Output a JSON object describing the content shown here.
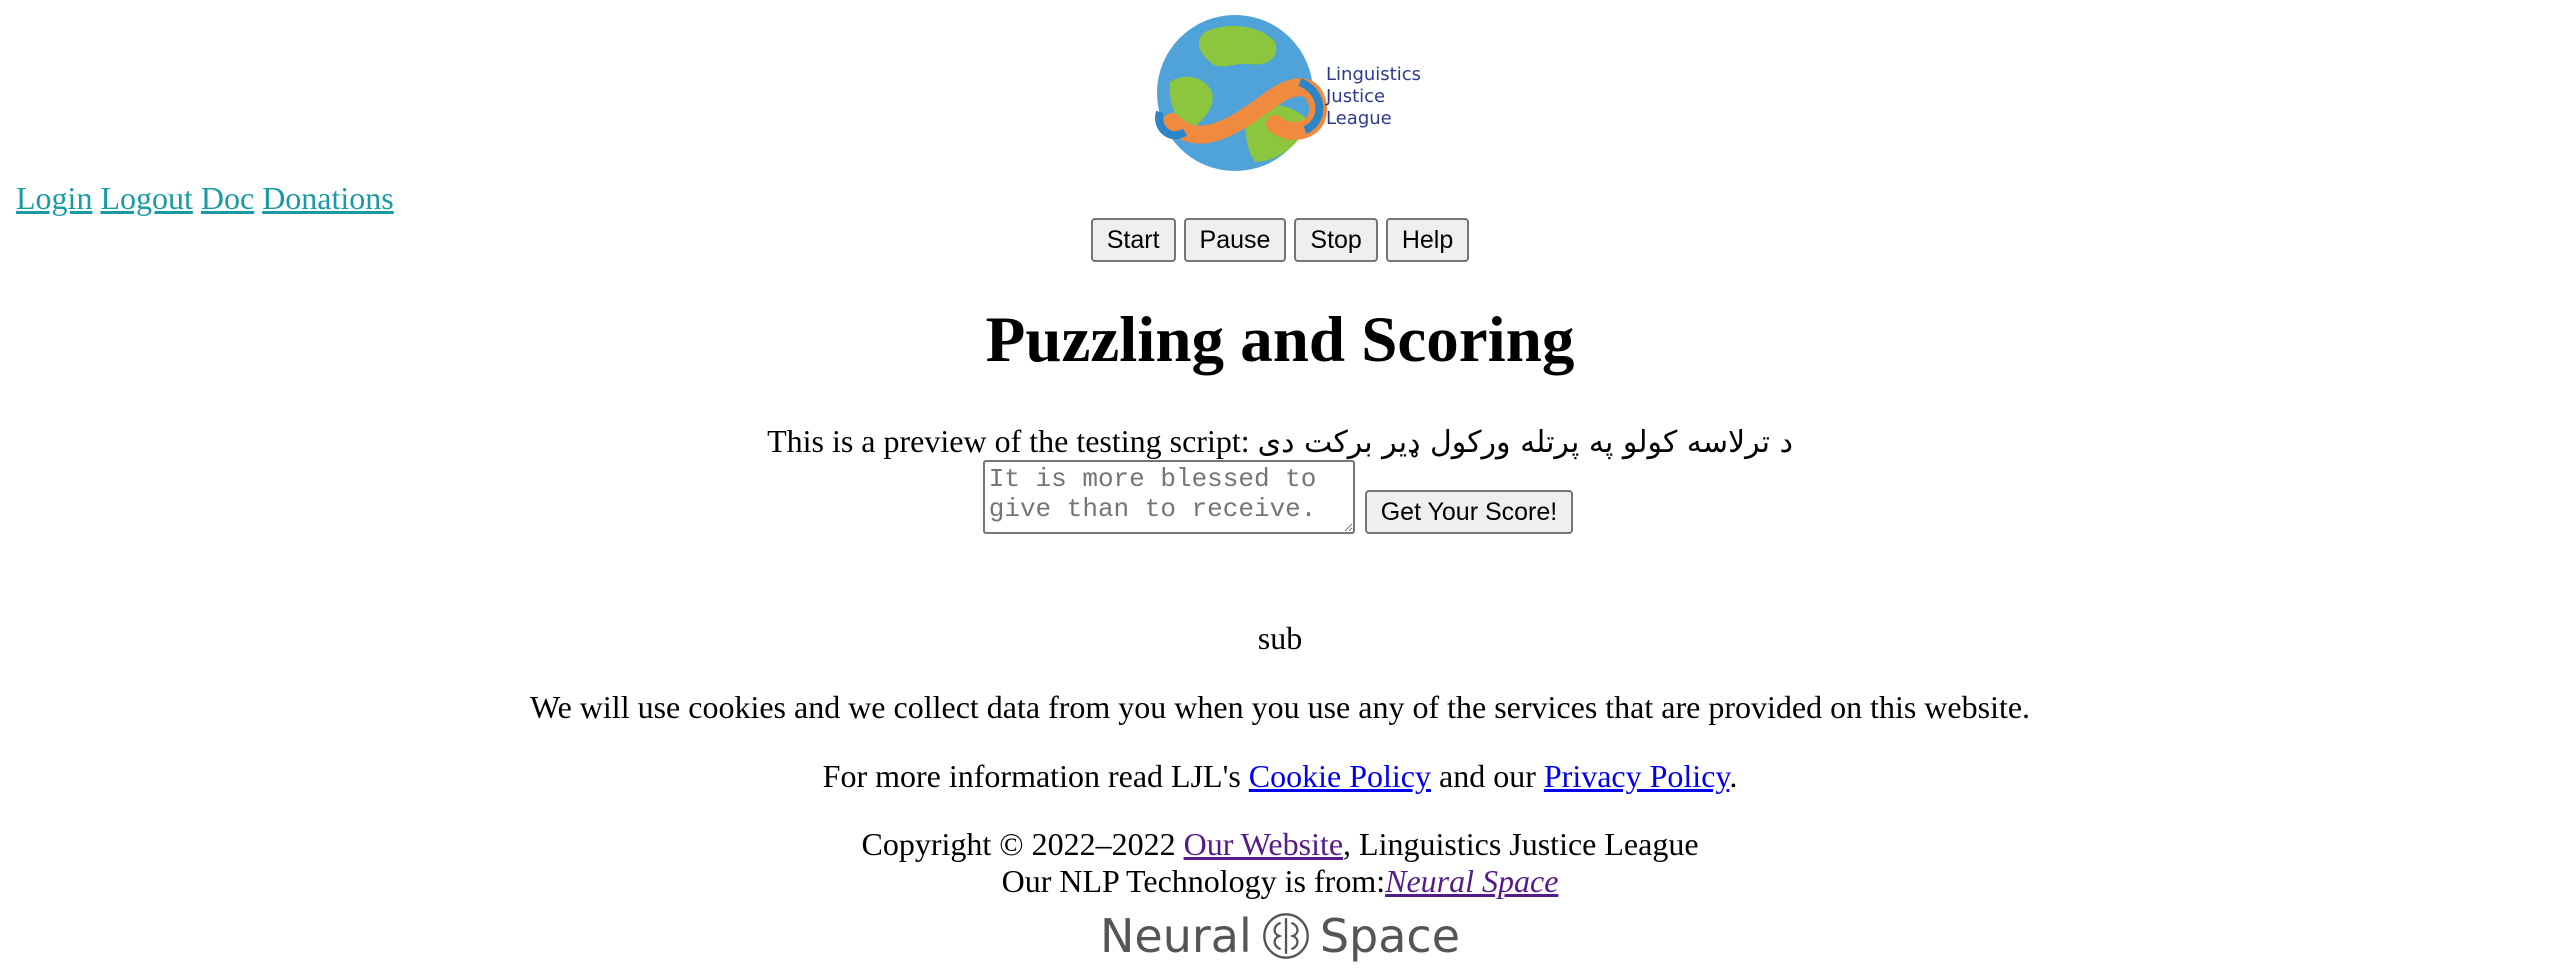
{
  "logo": {
    "text_lines": [
      "Linguistics",
      "Justice",
      "League"
    ],
    "colors": {
      "ocean": "#4fa3d9",
      "land": "#8cc63f",
      "band": "#f08a3e",
      "text": "#2d3a8c"
    }
  },
  "nav": {
    "links": [
      "Login",
      "Logout",
      "Doc",
      "Donations"
    ]
  },
  "controls": {
    "buttons": [
      "Start",
      "Pause",
      "Stop",
      "Help"
    ]
  },
  "main": {
    "title": "Puzzling and Scoring",
    "preview_prefix": "This is a preview of the testing script: ",
    "preview_script": "د ترلاسه کولو په پرتله ورکول ډیر برکت دی",
    "answer_placeholder": "It is more blessed to give than to receive.",
    "submit_label": "Get Your Score!",
    "sub_text": "sub"
  },
  "footer": {
    "cookie_notice": "We will use cookies and we collect data from you when you use any of the services that are provided on this website.",
    "more_info_prefix": "For more information read LJL's ",
    "cookie_policy_link": "Cookie Policy",
    "more_info_middle": " and our ",
    "privacy_policy_link": "Privacy Policy",
    "more_info_suffix": ".",
    "copyright_prefix": "Copyright © 2022–2022 ",
    "our_website_link": "Our Website",
    "copyright_suffix": ", Linguistics Justice League",
    "nlp_prefix": "Our NLP Technology is from:",
    "neural_space_link": "Neural Space",
    "ns_logo_left": "Neural",
    "ns_logo_right": "Space"
  },
  "colors": {
    "nav_link": "#1a9aa6",
    "link": "#0000ee",
    "visited_link": "#551a8b"
  }
}
